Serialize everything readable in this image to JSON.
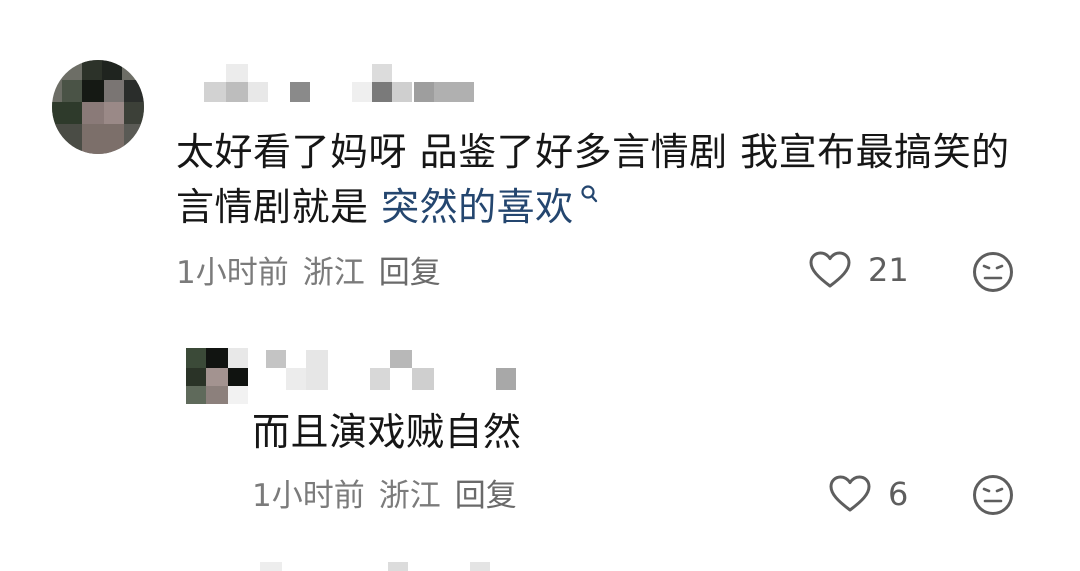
{
  "comments": [
    {
      "text": "太好看了妈呀 品鉴了好多言情剧 我宣布最搞笑的言情剧就是 ",
      "link_text": "突然的喜欢",
      "link_icon": "search-icon",
      "time": "1小时前",
      "location": "浙江",
      "reply_label": "回复",
      "likes": "21"
    }
  ],
  "replies": [
    {
      "text": "而且演戏贼自然",
      "time": "1小时前",
      "location": "浙江",
      "reply_label": "回复",
      "likes": "6"
    }
  ],
  "icons": {
    "like": "heart-outline-icon",
    "dislike": "unhappy-face-icon"
  },
  "colors": {
    "text": "#161616",
    "link": "#24466f",
    "meta": "#7b7b7b",
    "icon": "#5e5e5e"
  }
}
